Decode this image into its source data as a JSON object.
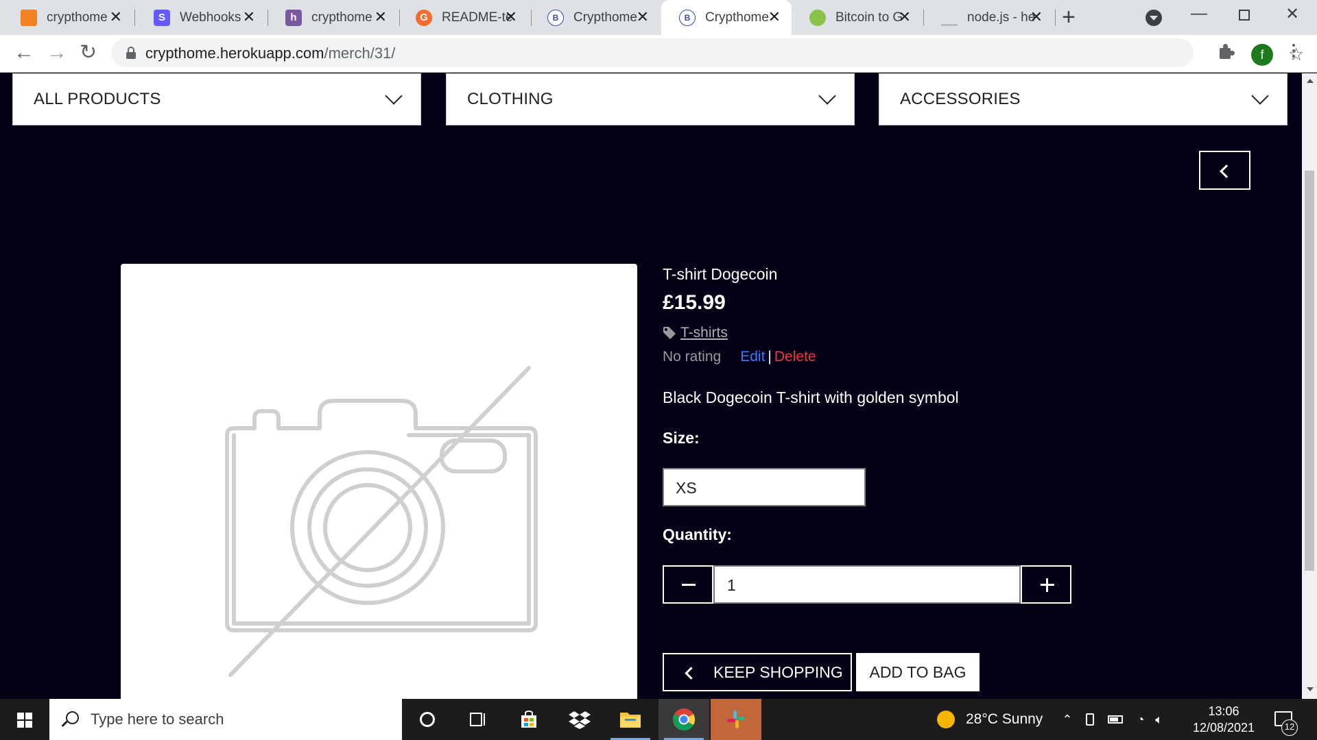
{
  "browser": {
    "tabs": [
      {
        "title": "crypthome",
        "favicon_color": "#f48024",
        "favicon_glyph": "",
        "active": false
      },
      {
        "title": "Webhooks",
        "favicon_color": "#635bff",
        "favicon_glyph": "S",
        "active": false
      },
      {
        "title": "crypthome",
        "favicon_color": "#79589f",
        "favicon_glyph": "h",
        "active": false
      },
      {
        "title": "README-te",
        "favicon_color": "#f56c2d",
        "favicon_glyph": "G",
        "active": false
      },
      {
        "title": "Crypthome",
        "favicon_color": "#ffffff",
        "favicon_glyph": "B",
        "active": false
      },
      {
        "title": "Crypthome",
        "favicon_color": "#ffffff",
        "favicon_glyph": "B",
        "active": true
      },
      {
        "title": "Bitcoin to G",
        "favicon_color": "#8bc34a",
        "favicon_glyph": "",
        "active": false
      },
      {
        "title": "node.js - he",
        "favicon_color": "#f48024",
        "favicon_glyph": "",
        "active": false
      }
    ],
    "new_tab_icon": "plus-icon",
    "url_host": "crypthome.herokuapp.com",
    "url_path": "/merch/31/",
    "avatar_letter": "f"
  },
  "page": {
    "nav": {
      "all_products": "ALL PRODUCTS",
      "clothing": "CLOTHING",
      "accessories": "ACCESSORIES"
    },
    "product": {
      "name": "T-shirt Dogecoin",
      "price": "£15.99",
      "category": "T-shirts",
      "rating": "No rating",
      "edit": "Edit",
      "divider": "|",
      "delete": "Delete",
      "description": "Black Dogecoin T-shirt with golden symbol",
      "size_label": "Size:",
      "size_value": "XS",
      "quantity_label": "Quantity:",
      "quantity_value": "1",
      "keep_shopping": "KEEP SHOPPING",
      "add_to_bag": "ADD TO BAG"
    },
    "colors": {
      "background": "#050218",
      "edit_link": "#3a7bff",
      "delete_link": "#e63946"
    }
  },
  "taskbar": {
    "search_placeholder": "Type here to search",
    "weather": "28°C  Sunny",
    "time": "13:06",
    "date": "12/08/2021",
    "notification_count": "12"
  }
}
